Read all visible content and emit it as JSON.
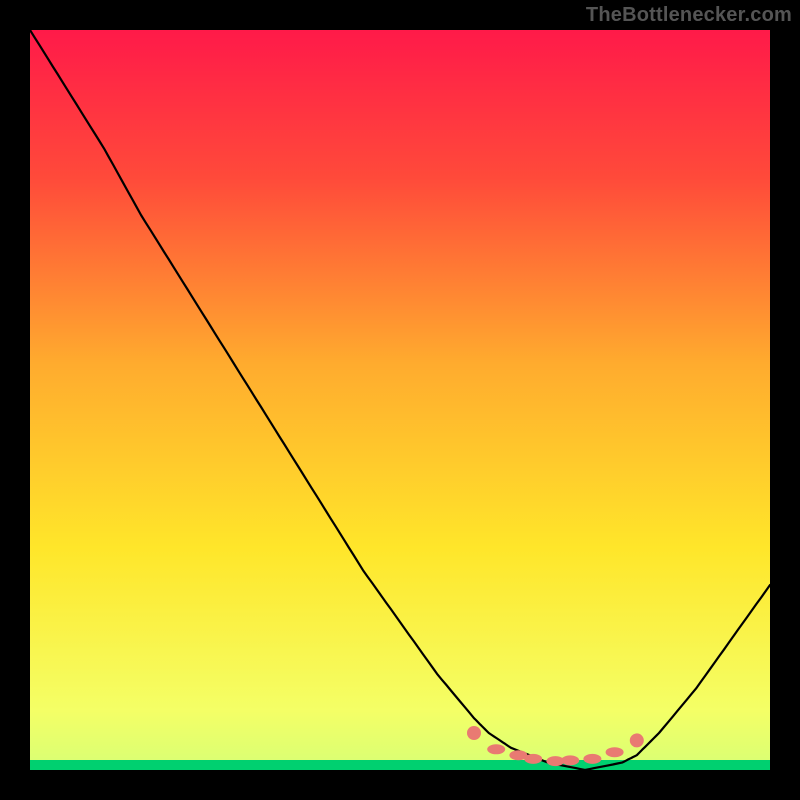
{
  "watermark": "TheBottlenecker.com",
  "chart_data": {
    "type": "line",
    "title": "",
    "xlabel": "",
    "ylabel": "",
    "xlim": [
      0,
      1
    ],
    "ylim": [
      0,
      1
    ],
    "gradient": {
      "top_color": "#ff1a49",
      "mid_color": "#ffe62a",
      "bottom_color": "#d7ff75",
      "bottom_stripe": "#00d070"
    },
    "series": [
      {
        "name": "bottleneck-curve",
        "x": [
          0.0,
          0.05,
          0.1,
          0.15,
          0.2,
          0.25,
          0.3,
          0.35,
          0.4,
          0.45,
          0.5,
          0.55,
          0.6,
          0.62,
          0.65,
          0.7,
          0.75,
          0.8,
          0.82,
          0.85,
          0.9,
          0.95,
          1.0
        ],
        "y": [
          1.0,
          0.92,
          0.84,
          0.75,
          0.67,
          0.59,
          0.51,
          0.43,
          0.35,
          0.27,
          0.2,
          0.13,
          0.07,
          0.05,
          0.03,
          0.01,
          0.0,
          0.01,
          0.02,
          0.05,
          0.11,
          0.18,
          0.25
        ]
      }
    ],
    "highlight_points": {
      "name": "optimal-zone",
      "color": "#e97a72",
      "points": [
        {
          "x": 0.6,
          "y": 0.05
        },
        {
          "x": 0.63,
          "y": 0.028
        },
        {
          "x": 0.66,
          "y": 0.02
        },
        {
          "x": 0.68,
          "y": 0.015
        },
        {
          "x": 0.71,
          "y": 0.012
        },
        {
          "x": 0.73,
          "y": 0.013
        },
        {
          "x": 0.76,
          "y": 0.015
        },
        {
          "x": 0.79,
          "y": 0.024
        },
        {
          "x": 0.82,
          "y": 0.04
        }
      ]
    }
  }
}
